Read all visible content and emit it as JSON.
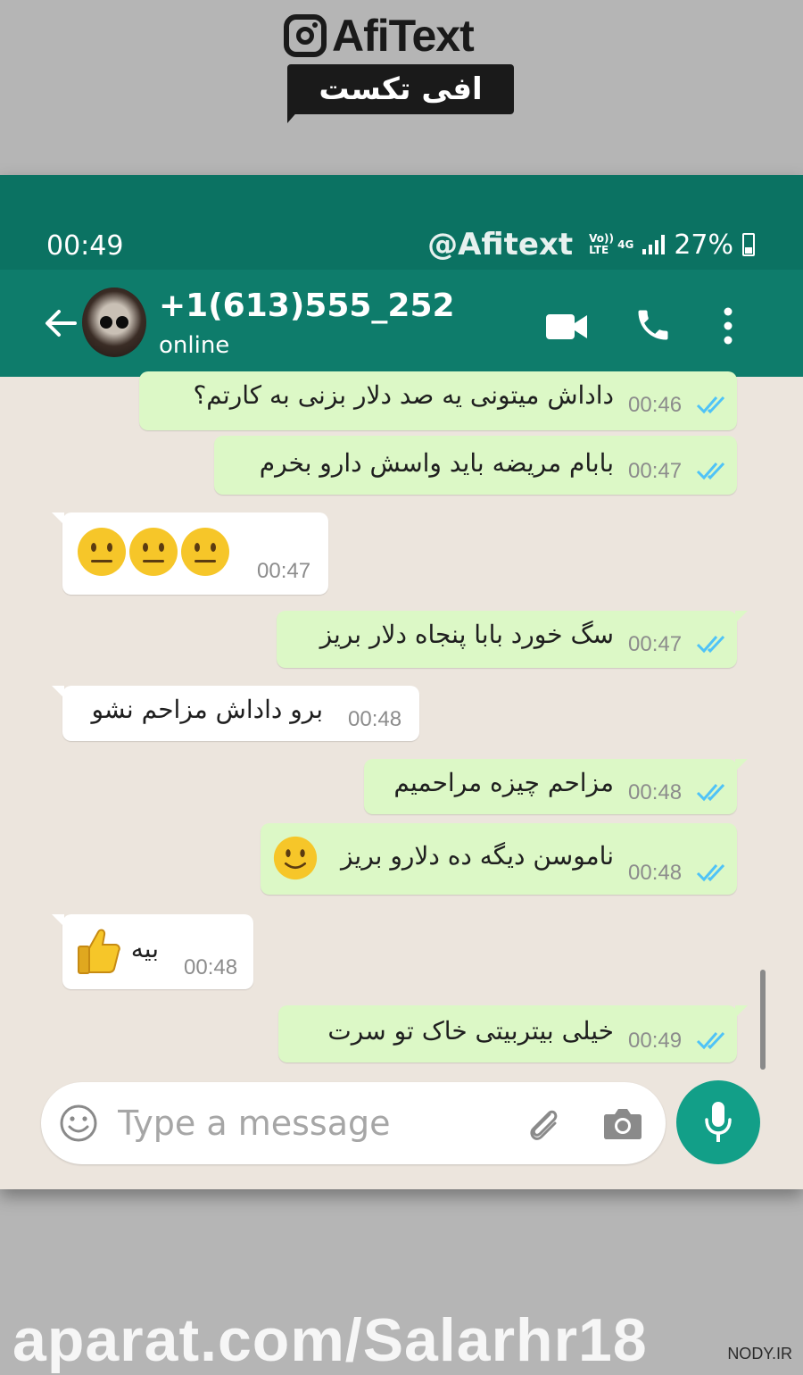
{
  "logo": {
    "name": "AfiText",
    "subtitle": "افی تکست",
    "icon": "instagram-icon"
  },
  "status_bar": {
    "time": "00:49",
    "watermark": "@Afitext",
    "volte": "Vo)) LTE",
    "network": "4G",
    "battery": "27%"
  },
  "header": {
    "contact": "+1(613)555_252",
    "status": "online",
    "icons": [
      "back-arrow-icon",
      "video-call-icon",
      "phone-icon",
      "more-vert-icon"
    ]
  },
  "messages": [
    {
      "dir": "out",
      "text": "داداش میتونی یه صد دلار بزنی به کارتم؟",
      "time": "00:46"
    },
    {
      "dir": "out",
      "text": "بابام مریضه باید واسش دارو بخرم",
      "time": "00:47"
    },
    {
      "dir": "in",
      "text": "",
      "emoji": "neutral-face x3",
      "time": "00:47"
    },
    {
      "dir": "out",
      "text": "سگ خورد بابا پنجاه دلار بریز",
      "time": "00:47"
    },
    {
      "dir": "in",
      "text": "برو داداش مزاحم نشو",
      "time": "00:48"
    },
    {
      "dir": "out",
      "text": "مزاحم چیزه مراحمیم",
      "time": "00:48"
    },
    {
      "dir": "out",
      "text": "ناموسن دیگه ده دلارو بریز",
      "emoji": "slight-smile",
      "time": "00:48"
    },
    {
      "dir": "in",
      "text": "بیه",
      "emoji": "thumbs-up",
      "time": "00:48"
    },
    {
      "dir": "out",
      "text": "خیلی بیتربیتی خاک تو سرت",
      "time": "00:49"
    }
  ],
  "input": {
    "placeholder": "Type a message"
  },
  "colors": {
    "header": "#0e7c6b",
    "status_bar": "#0b7262",
    "outgoing": "#dcf8c6",
    "incoming": "#ffffff",
    "tick_read": "#4fc3f7",
    "mic_button": "#129f88"
  },
  "footer": {
    "watermark": "aparat.com/Salarhr18",
    "site": "NODY.IR"
  }
}
